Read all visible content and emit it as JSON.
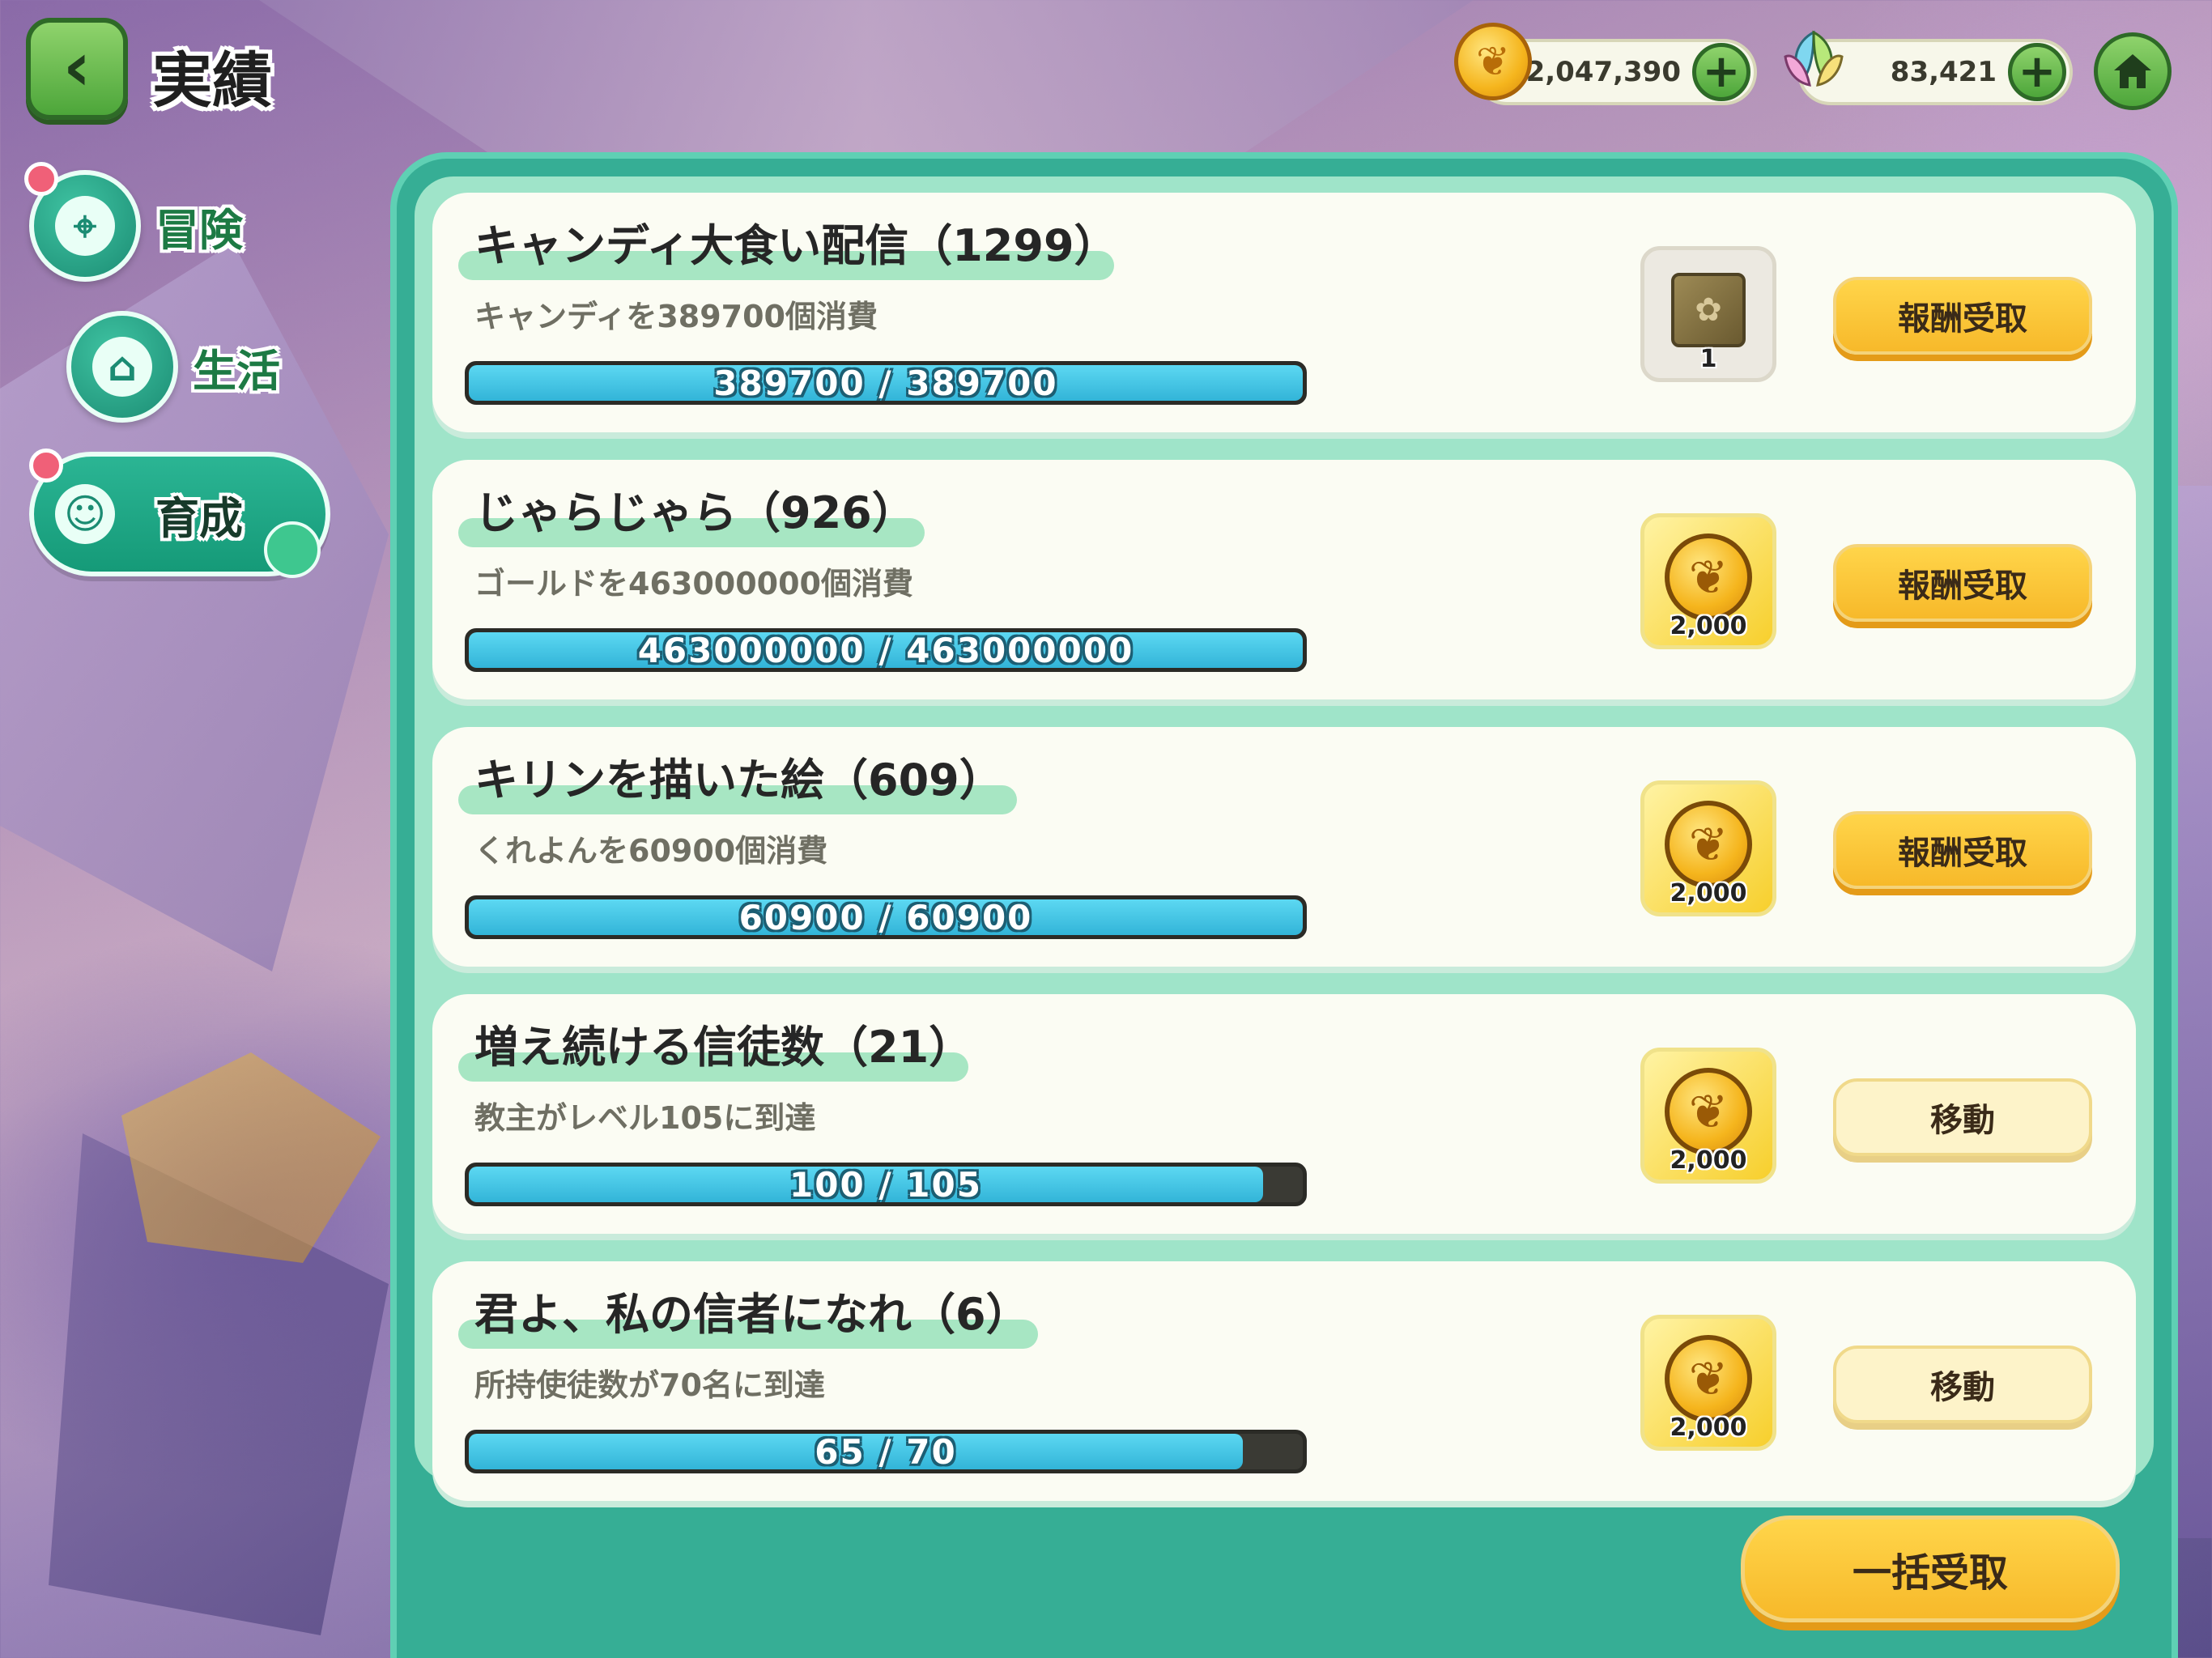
{
  "header": {
    "title": "実績"
  },
  "currencies": {
    "gold": "2,047,390",
    "gem": "83,421"
  },
  "nav": [
    {
      "label": "冒険",
      "badge": true
    },
    {
      "label": "生活",
      "badge": false
    },
    {
      "label": "育成",
      "badge": true,
      "selected": true
    }
  ],
  "achievements": [
    {
      "title": "キャンディ大食い配信（1299）",
      "desc": "キャンディを389700個消費",
      "progress": "389700 / 389700",
      "ratio": 1.0,
      "reward_type": "book",
      "reward_qty": "1",
      "button": "報酬受取",
      "button_type": "claim"
    },
    {
      "title": "じゃらじゃら（926）",
      "desc": "ゴールドを463000000個消費",
      "progress": "463000000 / 463000000",
      "ratio": 1.0,
      "reward_type": "gold",
      "reward_qty": "2,000",
      "button": "報酬受取",
      "button_type": "claim"
    },
    {
      "title": "キリンを描いた絵（609）",
      "desc": "くれよんを60900個消費",
      "progress": "60900 / 60900",
      "ratio": 1.0,
      "reward_type": "gold",
      "reward_qty": "2,000",
      "button": "報酬受取",
      "button_type": "claim"
    },
    {
      "title": "増え続ける信徒数（21）",
      "desc": "教主がレベル105に到達",
      "progress": "100 / 105",
      "ratio": 0.9524,
      "reward_type": "gold",
      "reward_qty": "2,000",
      "button": "移動",
      "button_type": "move"
    },
    {
      "title": "君よ、私の信者になれ（6）",
      "desc": "所持使徒数が70名に到達",
      "progress": "65 / 70",
      "ratio": 0.9286,
      "reward_type": "gold",
      "reward_qty": "2,000",
      "button": "移動",
      "button_type": "move"
    }
  ],
  "footer": {
    "bulk_button": "一括受取"
  }
}
